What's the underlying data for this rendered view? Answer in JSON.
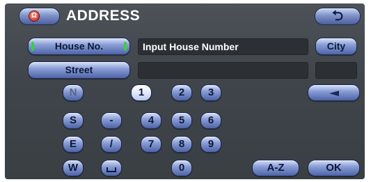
{
  "header": {
    "title": "ADDRESS",
    "home_icon_text": "Ω",
    "back_icon_text": "⮌"
  },
  "row1": {
    "house_no_label": "House No.",
    "input_text": "Input House Number",
    "city_label": "City"
  },
  "row2": {
    "street_label": "Street",
    "street_value": "",
    "extra_value": ""
  },
  "keys": {
    "n": "N",
    "s": "S",
    "e": "E",
    "w": "W",
    "dash": "-",
    "slash": "/",
    "d1": "1",
    "d2": "2",
    "d3": "3",
    "d4": "4",
    "d5": "5",
    "d6": "6",
    "d7": "7",
    "d8": "8",
    "d9": "9",
    "d0": "0"
  },
  "actions": {
    "az_label": "A-Z",
    "ok_label": "OK"
  },
  "colors": {
    "screen_bg": "#42474c",
    "button_blue": "#8a9ed6",
    "indicator_green": "#36d23c",
    "home_icon_red": "#c2281a"
  },
  "icons": {
    "home": "home-icon",
    "back": "back-arrow-icon",
    "delete": "delete-icon",
    "space": "space-icon"
  }
}
